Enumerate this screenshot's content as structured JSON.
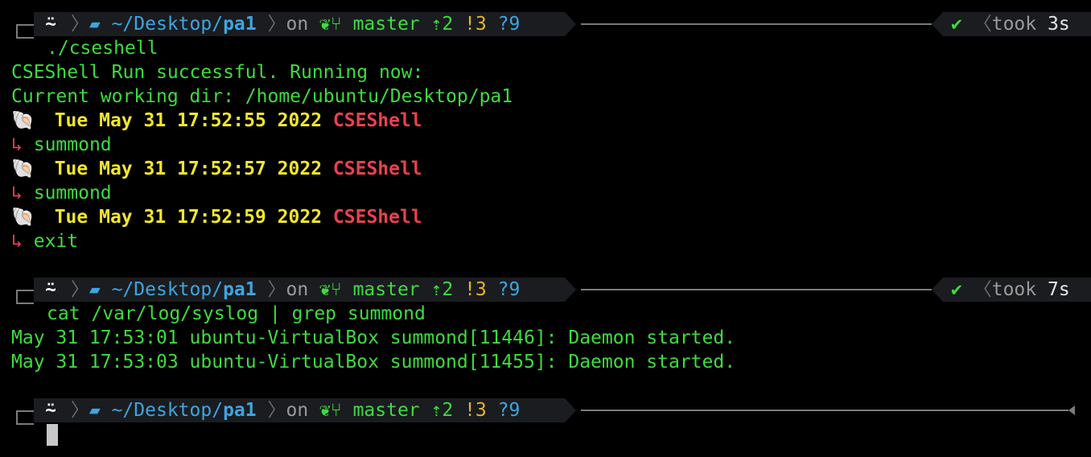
{
  "prompt": {
    "os_icon": "ubuntu-icon",
    "os_glyph": "⍨",
    "folder_glyph": "▰",
    "path_prefix": "~/Desktop/",
    "path_current": "pa1",
    "on_label": "on",
    "git_icon": "github-cat-icon",
    "git_glyph": "❦",
    "branch_glyph": "⑂",
    "branch": "master",
    "ahead": "⇡2",
    "modified": "!3",
    "untracked": "?9",
    "check": "✔",
    "took_label": "took"
  },
  "blocks": [
    {
      "took_time": "3s",
      "command": "./cseshell",
      "output": [
        "CSEShell Run successful. Running now:",
        "Current working dir: /home/ubuntu/Desktop/pa1"
      ],
      "shell_prompts": [
        {
          "timestamp": "Tue May 31 17:52:55 2022",
          "name": "CSEShell",
          "arrow": "↳",
          "input": "summond"
        },
        {
          "timestamp": "Tue May 31 17:52:57 2022",
          "name": "CSEShell",
          "arrow": "↳",
          "input": "summond"
        },
        {
          "timestamp": "Tue May 31 17:52:59 2022",
          "name": "CSEShell",
          "arrow": "↳",
          "input": "exit"
        }
      ]
    },
    {
      "took_time": "7s",
      "command": "cat /var/log/syslog | grep summond",
      "output": [
        "May 31 17:53:01 ubuntu-VirtualBox summond[11446]: Daemon started.",
        "May 31 17:53:03 ubuntu-VirtualBox summond[11455]: Daemon started."
      ]
    }
  ],
  "shell_emoji": "🐚",
  "colors": {
    "background": "#000000",
    "green": "#3ddc3d",
    "yellow": "#f2e52c",
    "red": "#e8414f",
    "blue": "#3da5e0",
    "orange": "#e8b429",
    "segment_bg": "#1a1c20"
  }
}
